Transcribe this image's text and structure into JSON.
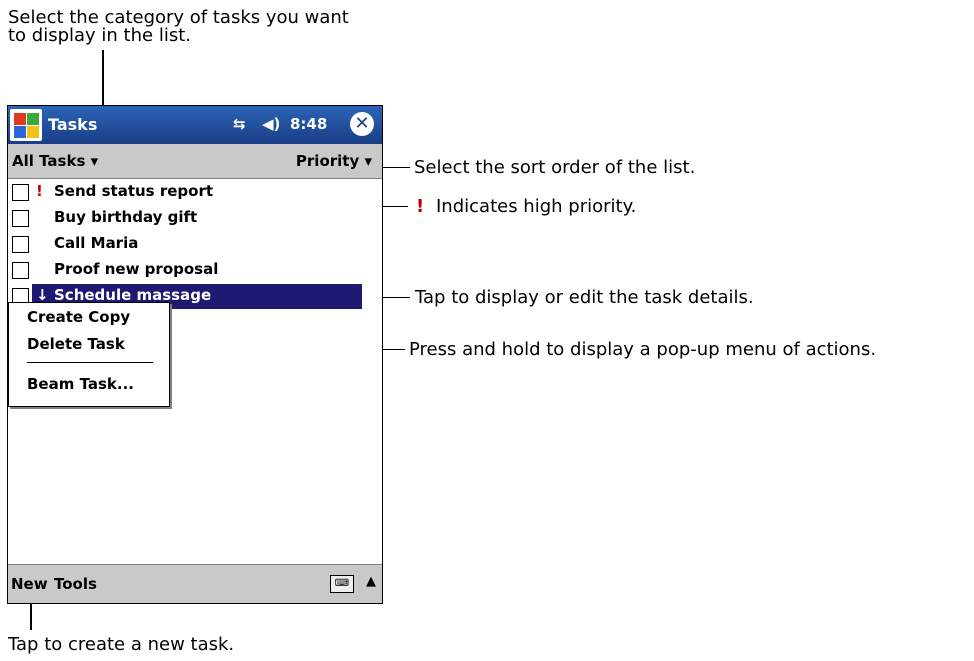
{
  "callouts": {
    "category": "Select the category of tasks you want\nto display in the list.",
    "category_line1": "Select the category of tasks you want",
    "category_line2": "to display in the list.",
    "sort": "Select the sort order of the list.",
    "priority_mark": "!",
    "priority": "Indicates high priority.",
    "details": "Tap to display or edit the task details.",
    "popup": "Press and hold to display a pop-up menu of actions.",
    "new": "Tap to create a new task."
  },
  "titlebar": {
    "title": "Tasks",
    "connectivity_icon": "connectivity-icon",
    "volume_icon": "volume-icon",
    "time": "8:48",
    "close_icon": "close-icon",
    "colors": {
      "bg": "#1a3e86",
      "text": "#ffffff"
    }
  },
  "toolbar": {
    "category_label": "All Tasks",
    "category_arrow": "▾",
    "sort_label": "Priority",
    "sort_arrow": "▾"
  },
  "tasks": [
    {
      "priority": "!",
      "label": "Send status report",
      "selected": false
    },
    {
      "priority": "",
      "label": "Buy birthday gift",
      "selected": false
    },
    {
      "priority": "",
      "label": "Call Maria",
      "selected": false
    },
    {
      "priority": "",
      "label": "Proof new proposal",
      "selected": false
    },
    {
      "priority": "↓",
      "label": "Schedule massage",
      "selected": true
    }
  ],
  "popup_menu": {
    "items": [
      "Create Copy",
      "Delete Task",
      "Beam Task..."
    ]
  },
  "bottombar": {
    "new_label": "New",
    "tools_label": "Tools",
    "keyboard_icon": "keyboard-icon",
    "arrow": "▲"
  },
  "colors": {
    "selection": "#1e1a72",
    "priority": "#c00000",
    "bar": "#c9c9c9"
  }
}
